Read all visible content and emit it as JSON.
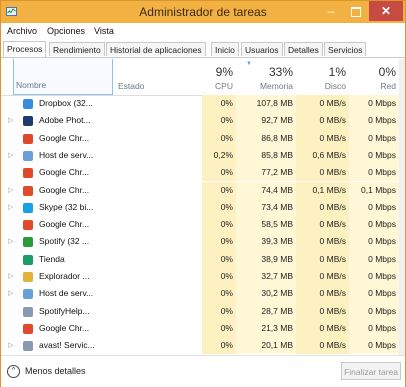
{
  "window": {
    "title": "Administrador de tareas"
  },
  "menu": [
    "Archivo",
    "Opciones",
    "Vista"
  ],
  "tabs": [
    "Procesos",
    "Rendimiento",
    "Historial de aplicaciones",
    "Inicio",
    "Usuarios",
    "Detalles",
    "Servicios"
  ],
  "columns": {
    "name": "Nombre",
    "status": "Estado",
    "cpu": {
      "pct": "9%",
      "label": "CPU"
    },
    "mem": {
      "pct": "33%",
      "label": "Memoria"
    },
    "disk": {
      "pct": "1%",
      "label": "Disco"
    },
    "net": {
      "pct": "0%",
      "label": "Red"
    }
  },
  "rows": [
    {
      "name": "Dropbox (32...",
      "cpu": "0%",
      "mem": "107,8 MB",
      "disk": "0 MB/s",
      "net": "0 Mbps",
      "icon": "dropbox-icon",
      "color": "#3a8be0",
      "expand": false
    },
    {
      "name": "Adobe Phot...",
      "cpu": "0%",
      "mem": "92,7 MB",
      "disk": "0 MB/s",
      "net": "0 Mbps",
      "icon": "photoshop-icon",
      "color": "#1f3a6b",
      "expand": true
    },
    {
      "name": "Google Chr...",
      "cpu": "0%",
      "mem": "86,8 MB",
      "disk": "0 MB/s",
      "net": "0 Mbps",
      "icon": "chrome-icon",
      "color": "#e04a2b",
      "expand": false
    },
    {
      "name": "Host de serv...",
      "cpu": "0,2%",
      "mem": "85,8 MB",
      "disk": "0,6 MB/s",
      "net": "0 Mbps",
      "icon": "service-host-icon",
      "color": "#6aa0d8",
      "expand": true
    },
    {
      "name": "Google Chr...",
      "cpu": "0%",
      "mem": "77,2 MB",
      "disk": "0 MB/s",
      "net": "0 Mbps",
      "icon": "chrome-icon",
      "color": "#e04a2b",
      "expand": false
    },
    {
      "name": "Google Chr...",
      "cpu": "0%",
      "mem": "74,4 MB",
      "disk": "0,1 MB/s",
      "net": "0,1 Mbps",
      "icon": "chrome-icon",
      "color": "#e04a2b",
      "expand": true
    },
    {
      "name": "Skype (32 bi...",
      "cpu": "0%",
      "mem": "73,4 MB",
      "disk": "0 MB/s",
      "net": "0 Mbps",
      "icon": "skype-icon",
      "color": "#17a2e6",
      "expand": true
    },
    {
      "name": "Google Chr...",
      "cpu": "0%",
      "mem": "58,5 MB",
      "disk": "0 MB/s",
      "net": "0 Mbps",
      "icon": "chrome-icon",
      "color": "#e04a2b",
      "expand": false
    },
    {
      "name": "Spotify (32 ...",
      "cpu": "0%",
      "mem": "39,3 MB",
      "disk": "0 MB/s",
      "net": "0 Mbps",
      "icon": "spotify-icon",
      "color": "#2a9a3a",
      "expand": true
    },
    {
      "name": "Tienda",
      "cpu": "0%",
      "mem": "38,9 MB",
      "disk": "0 MB/s",
      "net": "0 Mbps",
      "icon": "store-icon",
      "color": "#1b9a6a",
      "expand": false
    },
    {
      "name": "Explorador ...",
      "cpu": "0%",
      "mem": "32,7 MB",
      "disk": "0 MB/s",
      "net": "0 Mbps",
      "icon": "explorer-icon",
      "color": "#e0b43a",
      "expand": true
    },
    {
      "name": "Host de serv...",
      "cpu": "0%",
      "mem": "30,2 MB",
      "disk": "0 MB/s",
      "net": "0 Mbps",
      "icon": "service-host-icon",
      "color": "#6aa0d8",
      "expand": true
    },
    {
      "name": "SpotifyHelp...",
      "cpu": "0%",
      "mem": "28,7 MB",
      "disk": "0 MB/s",
      "net": "0 Mbps",
      "icon": "app-window-icon",
      "color": "#8a9ab0",
      "expand": false
    },
    {
      "name": "Google Chr...",
      "cpu": "0%",
      "mem": "21,3 MB",
      "disk": "0 MB/s",
      "net": "0 Mbps",
      "icon": "chrome-icon",
      "color": "#e04a2b",
      "expand": false
    },
    {
      "name": "avast! Servic...",
      "cpu": "0%",
      "mem": "20,1 MB",
      "disk": "0 MB/s",
      "net": "0 Mbps",
      "icon": "app-window-icon",
      "color": "#8a9ab0",
      "expand": true
    }
  ],
  "footer": {
    "less_details": "Menos detalles",
    "end_task": "Finalizar tarea"
  }
}
